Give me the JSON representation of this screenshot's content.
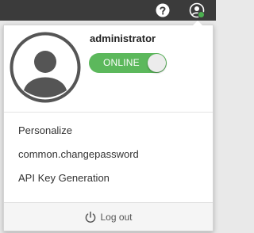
{
  "colors": {
    "topbar": "#3b3b3b",
    "online_green": "#5cb85c",
    "status_dot": "#4caf50"
  },
  "header": {
    "help_icon": "help-circle-icon",
    "user_icon": "user-circle-icon"
  },
  "user_menu": {
    "avatar_icon": "user-avatar-icon",
    "username": "administrator",
    "status_label": "ONLINE",
    "items": [
      {
        "label": "Personalize"
      },
      {
        "label": "common.changepassword"
      },
      {
        "label": "API Key Generation"
      }
    ],
    "logout_label": "Log out",
    "logout_icon": "power-icon"
  }
}
